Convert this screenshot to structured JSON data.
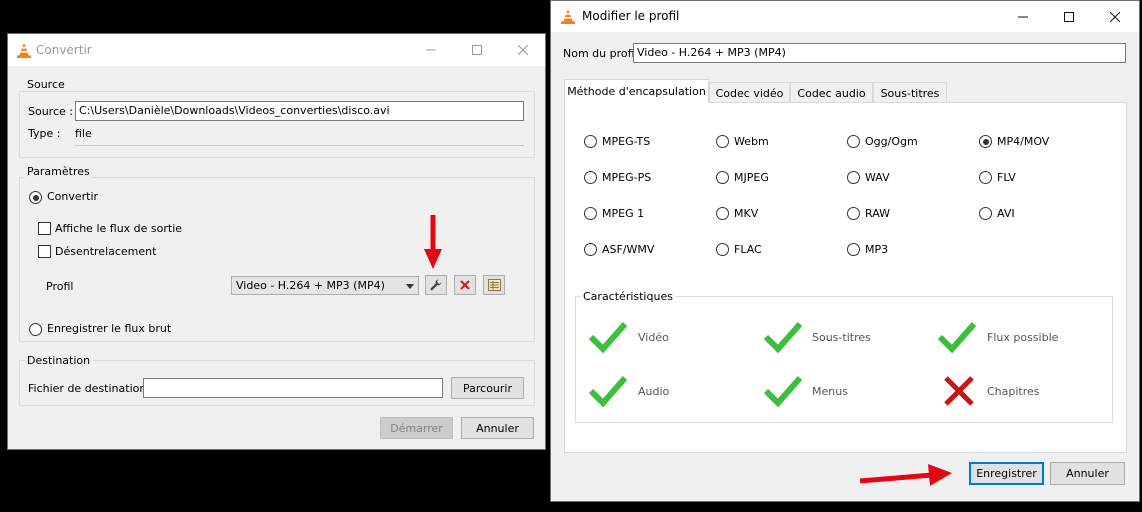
{
  "convert_window": {
    "title": "Convertir",
    "source_group": {
      "title": "Source",
      "source_label": "Source :",
      "source_value": "C:\\Users\\Danièle\\Downloads\\Videos_converties\\disco.avi",
      "type_label": "Type :",
      "type_value": "file"
    },
    "params_group": {
      "title": "Paramètres",
      "convert_label": "Convertir",
      "show_output_label": "Affiche le flux de sortie",
      "deinterlace_label": "Désentrelacement",
      "profile_label": "Profil",
      "profile_value": "Video - H.264 + MP3 (MP4)",
      "raw_dump_label": "Enregistrer le flux brut"
    },
    "destination_group": {
      "title": "Destination",
      "file_label": "Fichier de destination :",
      "file_value": "",
      "browse_label": "Parcourir"
    },
    "start_label": "Démarrer",
    "cancel_label": "Annuler"
  },
  "profile_window": {
    "title": "Modifier le profil",
    "name_label": "Nom du profil",
    "name_value": "Video - H.264 + MP3 (MP4)",
    "tabs": [
      "Méthode d'encapsulation",
      "Codec vidéo",
      "Codec audio",
      "Sous-titres"
    ],
    "formats": [
      "MPEG-TS",
      "Webm",
      "Ogg/Ogm",
      "MP4/MOV",
      "MPEG-PS",
      "MJPEG",
      "WAV",
      "FLV",
      "MPEG 1",
      "MKV",
      "RAW",
      "AVI",
      "ASF/WMV",
      "FLAC",
      "MP3"
    ],
    "selected_format": "MP4/MOV",
    "features_title": "Caractéristiques",
    "features": [
      {
        "label": "Vidéo",
        "supported": true
      },
      {
        "label": "Sous-titres",
        "supported": true
      },
      {
        "label": "Flux possible",
        "supported": true
      },
      {
        "label": "Audio",
        "supported": true
      },
      {
        "label": "Menus",
        "supported": true
      },
      {
        "label": "Chapitres",
        "supported": false
      }
    ],
    "save_label": "Enregistrer",
    "cancel_label": "Annuler"
  },
  "colors": {
    "check_green": "#3cbf3c",
    "cross_red": "#c81414",
    "annotation_red": "#e30613",
    "accent_blue": "#0078d7",
    "vlc_orange": "#f58220"
  }
}
